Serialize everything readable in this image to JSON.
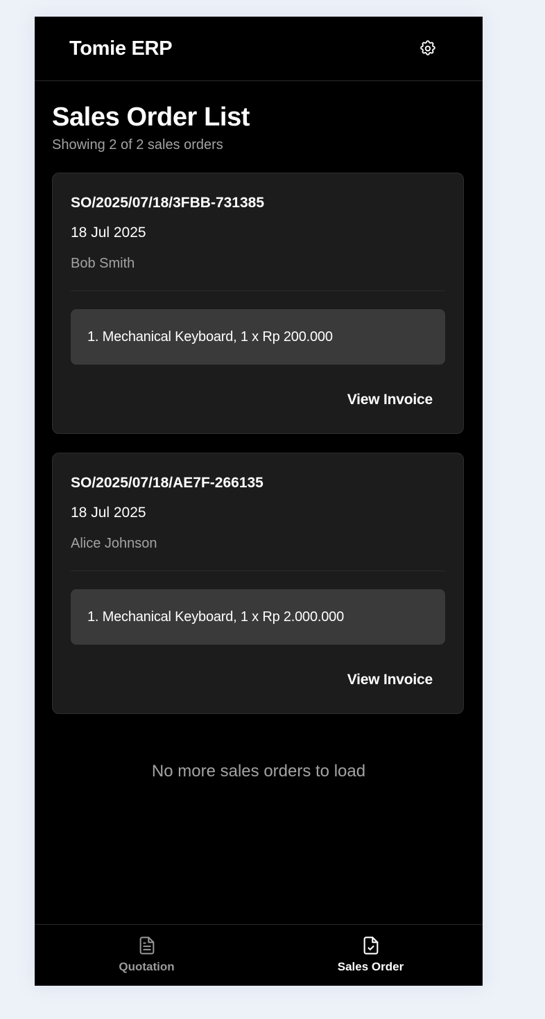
{
  "app": {
    "title": "Tomie ERP"
  },
  "page": {
    "title": "Sales Order List",
    "subtitle": "Showing 2 of 2 sales orders",
    "end_message": "No more sales orders to load"
  },
  "orders": [
    {
      "number": "SO/2025/07/18/3FBB-731385",
      "date": "18 Jul 2025",
      "customer": "Bob Smith",
      "item": "1. Mechanical Keyboard, 1 x Rp 200.000",
      "action": "View Invoice"
    },
    {
      "number": "SO/2025/07/18/AE7F-266135",
      "date": "18 Jul 2025",
      "customer": "Alice Johnson",
      "item": "1. Mechanical Keyboard, 1 x Rp 2.000.000",
      "action": "View Invoice"
    }
  ],
  "nav": {
    "items": [
      {
        "label": "Quotation",
        "icon": "document-icon",
        "active": false
      },
      {
        "label": "Sales Order",
        "icon": "document-check-icon",
        "active": true
      }
    ]
  },
  "colors": {
    "page_bg": "#edf1f8",
    "app_bg": "#000000",
    "card_bg": "#1c1c1c",
    "item_bg": "#3a3a3a",
    "muted_text": "#a3a3a3"
  }
}
